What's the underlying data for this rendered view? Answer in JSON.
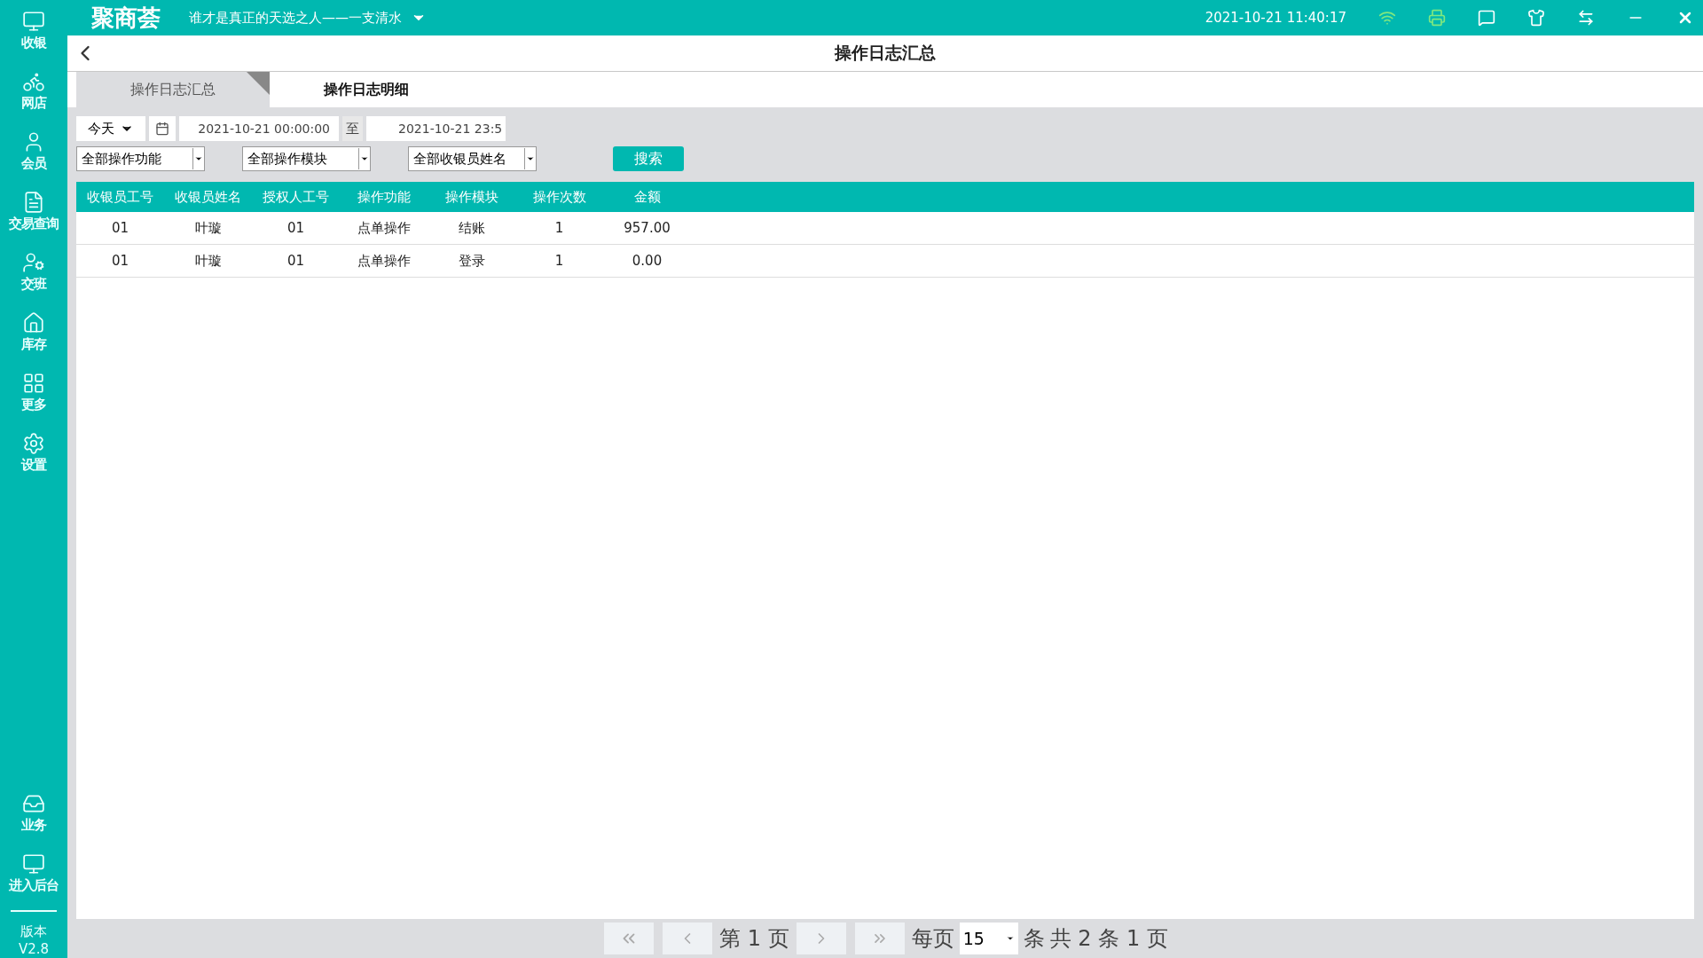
{
  "app": {
    "logo": "聚商荟",
    "store": "谁才是真正的天选之人——一支清水",
    "datetime": "2021-10-21 11:40:17"
  },
  "sidebar": {
    "items": [
      {
        "label": "收银"
      },
      {
        "label": "网店"
      },
      {
        "label": "会员"
      },
      {
        "label": "交易查询"
      },
      {
        "label": "交班"
      },
      {
        "label": "库存"
      },
      {
        "label": "更多"
      },
      {
        "label": "设置"
      }
    ],
    "bottom_items": [
      {
        "label": "业务"
      },
      {
        "label": "进入后台"
      }
    ],
    "version_label": "版本",
    "version": "V2.8"
  },
  "page": {
    "title": "操作日志汇总"
  },
  "tabs": [
    {
      "label": "操作日志汇总",
      "selected": true
    },
    {
      "label": "操作日志明细",
      "selected": false
    }
  ],
  "filters": {
    "period": "今天",
    "date_from": "2021-10-21 00:00:00",
    "to_label": "至",
    "date_to": "2021-10-21 23:5",
    "selects": [
      "全部操作功能",
      "全部操作模块",
      "全部收银员姓名"
    ],
    "search_button": "搜索"
  },
  "table": {
    "columns": [
      "收银员工号",
      "收银员姓名",
      "授权人工号",
      "操作功能",
      "操作模块",
      "操作次数",
      "金额"
    ],
    "rows": [
      [
        "01",
        "叶璇",
        "01",
        "点单操作",
        "结账",
        "1",
        "957.00"
      ],
      [
        "01",
        "叶璇",
        "01",
        "点单操作",
        "登录",
        "1",
        "0.00"
      ]
    ]
  },
  "pager": {
    "page_label": "第 1 页",
    "per_page_label": "每页",
    "per_page": "15",
    "per_page_unit": "条",
    "total": "共 2 条 1 页"
  }
}
